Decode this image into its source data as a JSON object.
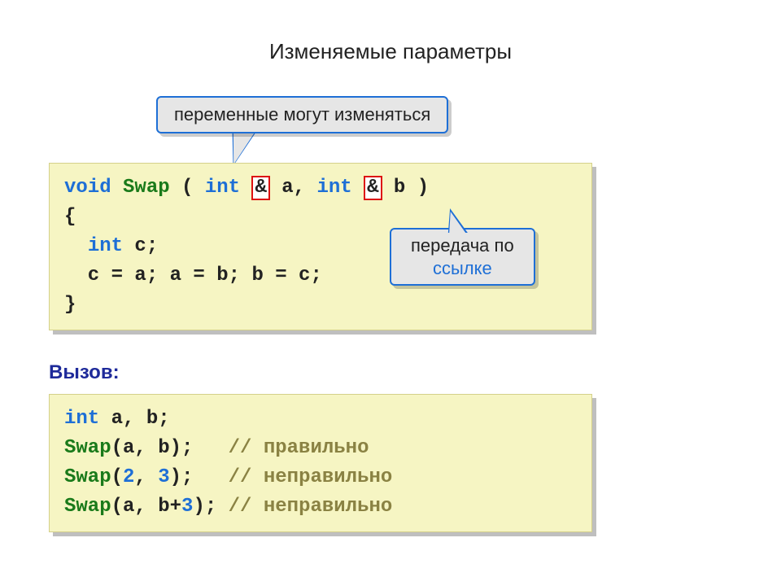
{
  "title": "Изменяемые параметры",
  "callout_top": "переменные могут изменяться",
  "callout_right_line1": "передача по",
  "callout_right_line2": "ссылке",
  "call_label": "Вызов:",
  "code1": {
    "kw_void": "void",
    "fn_name": "Swap",
    "open": " ( ",
    "kw_int": "int",
    "amp": "&",
    "param_a": " a, ",
    "param_b": " b )",
    "brace_open": "{",
    "decl_c": " c;",
    "assign_line": "  c = a; a = b; b = c;",
    "brace_close": "}"
  },
  "code2": {
    "decl": " a, b;",
    "call1_fn": "Swap",
    "call1_args": "(a, b);   ",
    "call1_comment": "// правильно",
    "call2_fn": "Swap",
    "call2_open": "(",
    "call2_n1": "2",
    "call2_sep": ", ",
    "call2_n2": "3",
    "call2_close": ");   ",
    "call2_comment": "// неправильно",
    "call3_fn": "Swap",
    "call3_args_a": "(a, b+",
    "call3_n": "3",
    "call3_args_b": "); ",
    "call3_comment": "// неправильно"
  }
}
